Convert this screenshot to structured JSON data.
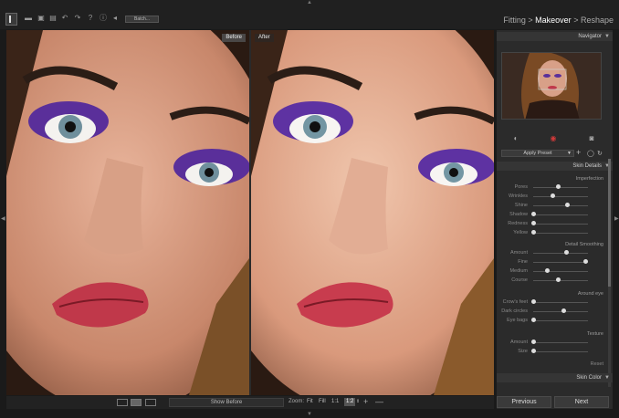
{
  "toolbar": {
    "batch_label": "Batch...",
    "icons": [
      "app-logo",
      "open-folder-icon",
      "save-icon",
      "save-as-icon",
      "undo-icon",
      "redo-icon",
      "help-icon",
      "info-icon",
      "share-icon"
    ]
  },
  "workflow": {
    "step1": "Fitting",
    "sep1": ">",
    "step2": "Makeover",
    "sep2": ">",
    "step3": "Reshape",
    "active": "Makeover"
  },
  "viewer": {
    "before_label": "Before",
    "after_label": "After"
  },
  "bottom": {
    "show_before": "Show Before",
    "zoom_label": "Zoom:",
    "zoom_fit": "Fit",
    "zoom_fill": "Fill",
    "zoom_1_1": "1:1",
    "zoom_1_2": "1:2",
    "zoom_selected": "1:2",
    "zoom_in": "+",
    "zoom_out": "—"
  },
  "panel": {
    "navigator_title": "Navigator",
    "apply_preset": "Apply Preset",
    "skin_details_title": "Skin Details",
    "imperfection_group": "Imperfection",
    "imperfection": [
      {
        "label": "Pores",
        "value": 0.45
      },
      {
        "label": "Wrinkles",
        "value": 0.35
      },
      {
        "label": "Shine",
        "value": 0.62
      },
      {
        "label": "Shadow",
        "value": 0.0
      },
      {
        "label": "Redness",
        "value": 0.0
      },
      {
        "label": "Yellow",
        "value": 0.0
      }
    ],
    "detail_group": "Detail Smoothing",
    "detail": [
      {
        "label": "Amount",
        "value": 0.6
      },
      {
        "label": "Fine",
        "value": 0.96
      },
      {
        "label": "Medium",
        "value": 0.25
      },
      {
        "label": "Course",
        "value": 0.45
      }
    ],
    "around_eye_group": "Around eye",
    "around_eye": [
      {
        "label": "Crow's feet",
        "value": 0.0
      },
      {
        "label": "Dark circles",
        "value": 0.56
      },
      {
        "label": "Eye bags",
        "value": 0.0
      }
    ],
    "texture_group": "Texture",
    "texture": [
      {
        "label": "Amount",
        "value": 0.0
      },
      {
        "label": "Size",
        "value": 0.0
      }
    ],
    "reset_label": "Reset",
    "skin_color_title": "Skin Color",
    "previous_label": "Previous",
    "next_label": "Next"
  },
  "colors": {
    "background": "#1a1a1a",
    "panel": "#2b2b2b",
    "accent_red": "#d23a3a"
  }
}
